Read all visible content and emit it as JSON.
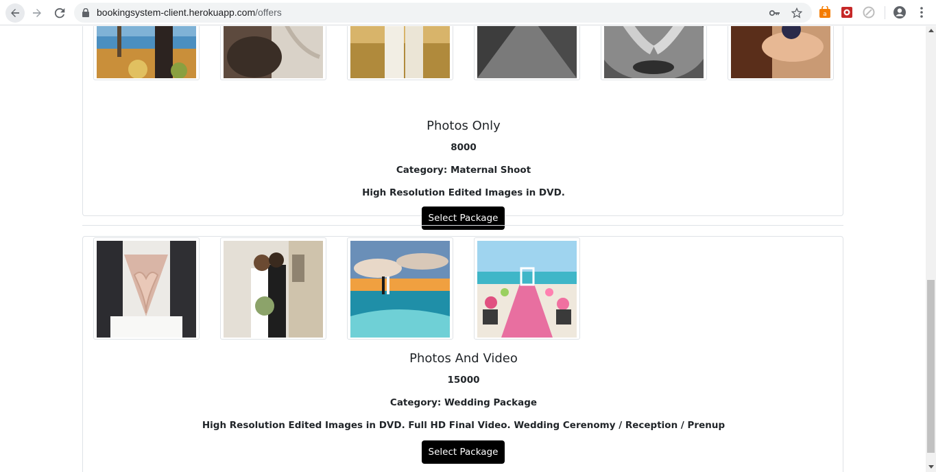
{
  "browser": {
    "url_host": "bookingsystem-client.herokuapp.com",
    "url_path": "/offers",
    "icons": [
      "back-icon",
      "forward-icon",
      "reload-icon",
      "lock-icon",
      "key-icon",
      "star-icon",
      "extension-icon",
      "extension-icon",
      "extension-icon",
      "account-icon",
      "menu-icon"
    ]
  },
  "packages": [
    {
      "title": "Photos Only",
      "price": "8000",
      "category": "Category: Maternal Shoot",
      "description": "High Resolution Edited Images in DVD.",
      "button_label": "Select Package",
      "photo_count": 6
    },
    {
      "title": "Photos And Video",
      "price": "15000",
      "category": "Category: Wedding Package",
      "description": "High Resolution Edited Images in DVD. Full HD Final Video. Wedding Cerenomy / Reception / Prenup",
      "button_label": "Select Package",
      "photo_count": 4
    }
  ],
  "colors": {
    "button_bg": "#000000",
    "border": "#dee2e6",
    "extension_orange": "#f57c00",
    "extension_red": "#c62828"
  }
}
